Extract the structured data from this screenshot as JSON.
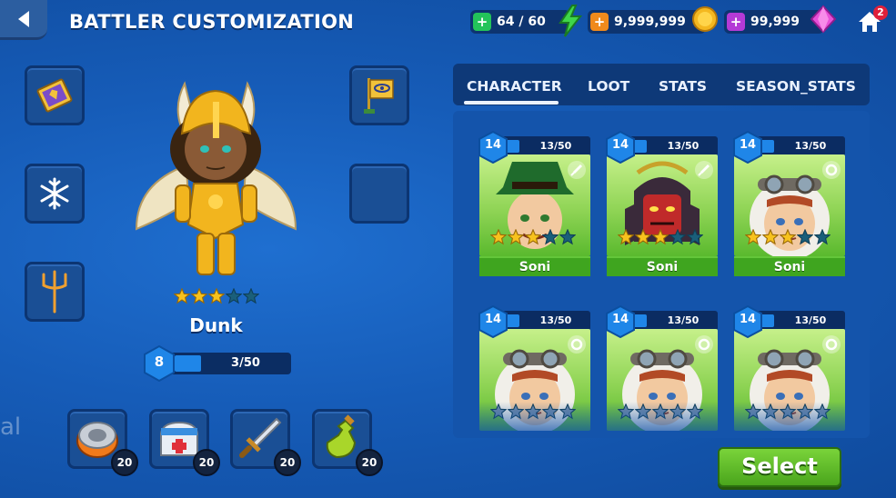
{
  "header": {
    "title": "BATTLER CUSTOMIZATION"
  },
  "resources": {
    "energy": {
      "value": "64 / 60",
      "icon": "lightning-icon",
      "color": "#23c45a"
    },
    "gold": {
      "value": "9,999,999",
      "icon": "coin-icon",
      "color": "#f08a1c"
    },
    "gems": {
      "value": "99,999",
      "icon": "gem-icon",
      "color": "#b43ad6"
    }
  },
  "home": {
    "badge": "2"
  },
  "hero": {
    "name": "Dunk",
    "stars": 3,
    "max_stars": 5,
    "level": "8",
    "progress": "3/50",
    "progress_value": 3,
    "progress_max": 50
  },
  "equipment_slots": [
    {
      "icon": "banner-card-icon"
    },
    {
      "icon": "banner-flag-icon"
    },
    {
      "icon": "snowflake-icon"
    },
    {
      "icon": "empty-slot"
    },
    {
      "icon": "trident-icon"
    }
  ],
  "items": [
    {
      "icon": "tape-roll-icon",
      "count": "20"
    },
    {
      "icon": "medkit-icon",
      "count": "20"
    },
    {
      "icon": "sword-icon",
      "count": "20"
    },
    {
      "icon": "potion-icon",
      "count": "20"
    }
  ],
  "tabs": [
    {
      "label": "CHARACTER",
      "active": true
    },
    {
      "label": "LOOT",
      "active": false
    },
    {
      "label": "STATS",
      "active": false
    },
    {
      "label": "SEASON_STATS",
      "active": false
    }
  ],
  "characters": [
    {
      "level": "14",
      "progress": "13/50",
      "name": "Soni",
      "stars": 3,
      "portrait": "green-hat-boy"
    },
    {
      "level": "14",
      "progress": "13/50",
      "name": "Soni",
      "stars": 3,
      "portrait": "samurai"
    },
    {
      "level": "14",
      "progress": "13/50",
      "name": "Soni",
      "stars": 3,
      "portrait": "aviator"
    },
    {
      "level": "14",
      "progress": "13/50",
      "name": "",
      "stars": 0,
      "portrait": "aviator"
    },
    {
      "level": "14",
      "progress": "13/50",
      "name": "",
      "stars": 0,
      "portrait": "aviator"
    },
    {
      "level": "14",
      "progress": "13/50",
      "name": "",
      "stars": 0,
      "portrait": "aviator"
    }
  ],
  "select_button": {
    "label": "Select"
  },
  "edge_text": "al",
  "colors": {
    "tab_active": "#eaf2ff",
    "select_green": "#4aa51c",
    "card_green": "#3fa51f"
  }
}
